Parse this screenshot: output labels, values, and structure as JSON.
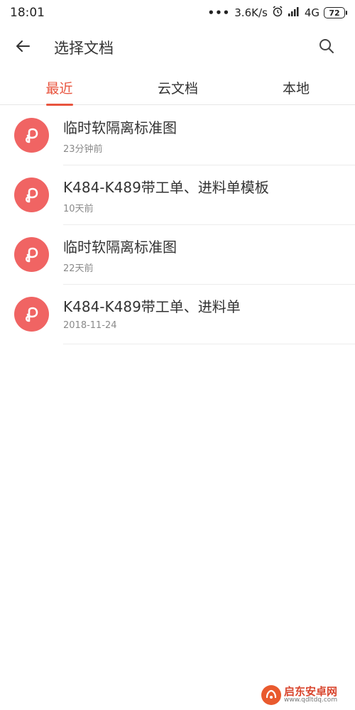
{
  "status_bar": {
    "time": "18:01",
    "dots": "•••",
    "speed": "3.6K/s",
    "network": "4G",
    "battery": "72"
  },
  "app_bar": {
    "title": "选择文档",
    "back_icon": "arrow-left-icon",
    "search_icon": "search-icon"
  },
  "tabs": [
    {
      "label": "最近",
      "active": true
    },
    {
      "label": "云文档",
      "active": false
    },
    {
      "label": "本地",
      "active": false
    }
  ],
  "accent_color": "#e8543e",
  "icon_color": "#f06463",
  "documents": [
    {
      "name": "临时软隔离标准图",
      "time": "23分钟前",
      "icon": "wps-pdf-icon"
    },
    {
      "name": "K484-K489带工单、进料单模板",
      "time": "10天前",
      "icon": "wps-pdf-icon"
    },
    {
      "name": "临时软隔离标准图",
      "time": "22天前",
      "icon": "wps-pdf-icon"
    },
    {
      "name": "K484-K489带工单、进料单",
      "time": "2018-11-24",
      "icon": "wps-pdf-icon"
    }
  ],
  "watermark": {
    "text": "启东安卓网",
    "url": "www.qdltdq.com"
  }
}
